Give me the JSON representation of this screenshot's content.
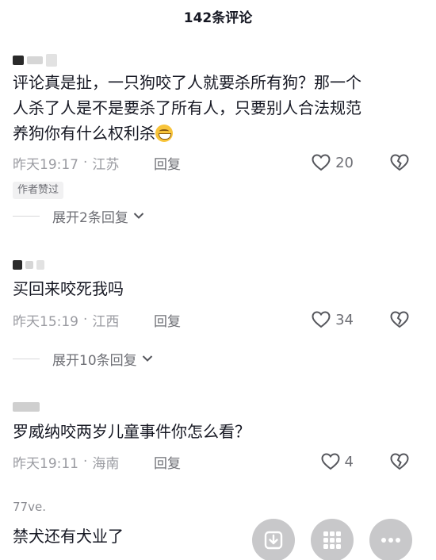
{
  "header": {
    "title": "142条评论"
  },
  "comments": [
    {
      "text_lines": [
        "评论真是扯，一只狗咬了人就要杀所有狗？那一个",
        "人杀了人是不是要杀了所有人，只要别人合法规范",
        "养狗你有什么权利杀"
      ],
      "time": "昨天19:17",
      "location": "江苏",
      "reply_label": "回复",
      "likes": "20",
      "badge": "作者赞过",
      "expand_label": "展开2条回复"
    },
    {
      "text_lines": [
        "买回来咬死我吗"
      ],
      "time": "昨天15:19",
      "location": "江西",
      "reply_label": "回复",
      "likes": "34",
      "expand_label": "展开10条回复"
    },
    {
      "text_lines": [
        "罗威纳咬两岁儿童事件你怎么看？"
      ],
      "time": "昨天19:11",
      "location": "海南",
      "reply_label": "回复",
      "likes": "4"
    },
    {
      "username": "77ve.",
      "text_lines": [
        "禁犬还有犬业了"
      ]
    }
  ],
  "floating_buttons": [
    "download-icon",
    "grid-icon",
    "more-icon"
  ],
  "colors": {
    "text": "#161823",
    "meta": "#9a9ba1",
    "secondary": "#6e6f75"
  }
}
